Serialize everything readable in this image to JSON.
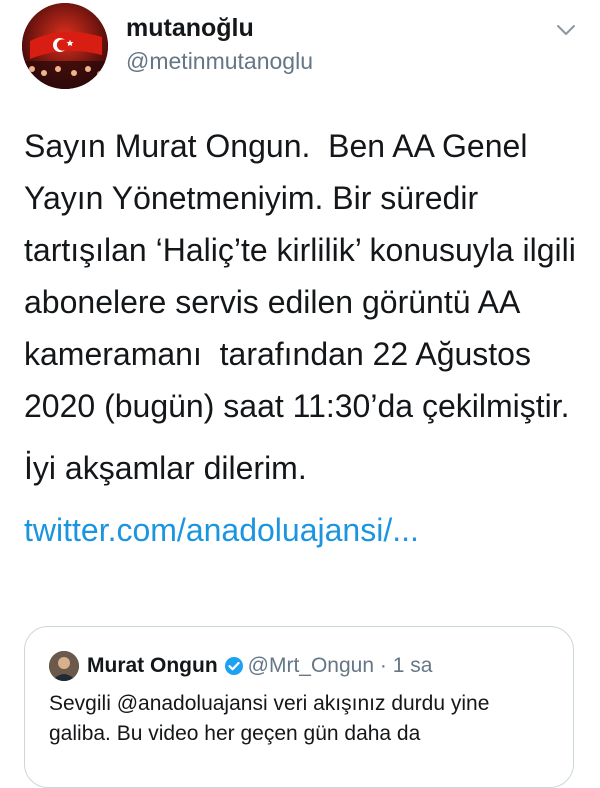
{
  "author": {
    "display_name": "mutanoğlu",
    "handle": "@metinmutanoglu"
  },
  "tweet": {
    "paragraph1": "Sayın Murat Ongun.  Ben AA Genel Yayın Yönetmeniyim. Bir süredir tartışılan ‘Haliç’te kirlilik’ konusuyla ilgili abonelere servis edilen görüntü AA kameramanı  tarafından 22 Ağustos 2020 (bugün) saat 11:30’da çekilmiştir.",
    "paragraph2": "İyi akşamlar dilerim.",
    "link": "twitter.com/anadoluajansi/..."
  },
  "quoted": {
    "name": "Murat Ongun",
    "handle": "@Mrt_Ongun",
    "separator": " · ",
    "time": "1 sa",
    "text": "Sevgili @anadoluajansi veri akışınız durdu yine galiba. Bu video her geçen gün daha da"
  },
  "colors": {
    "link": "#1b95e0",
    "verified": "#1da1f2",
    "secondary_text": "#657786"
  },
  "icons": {
    "more": "chevron-down-icon",
    "verified": "verified-badge-icon"
  }
}
